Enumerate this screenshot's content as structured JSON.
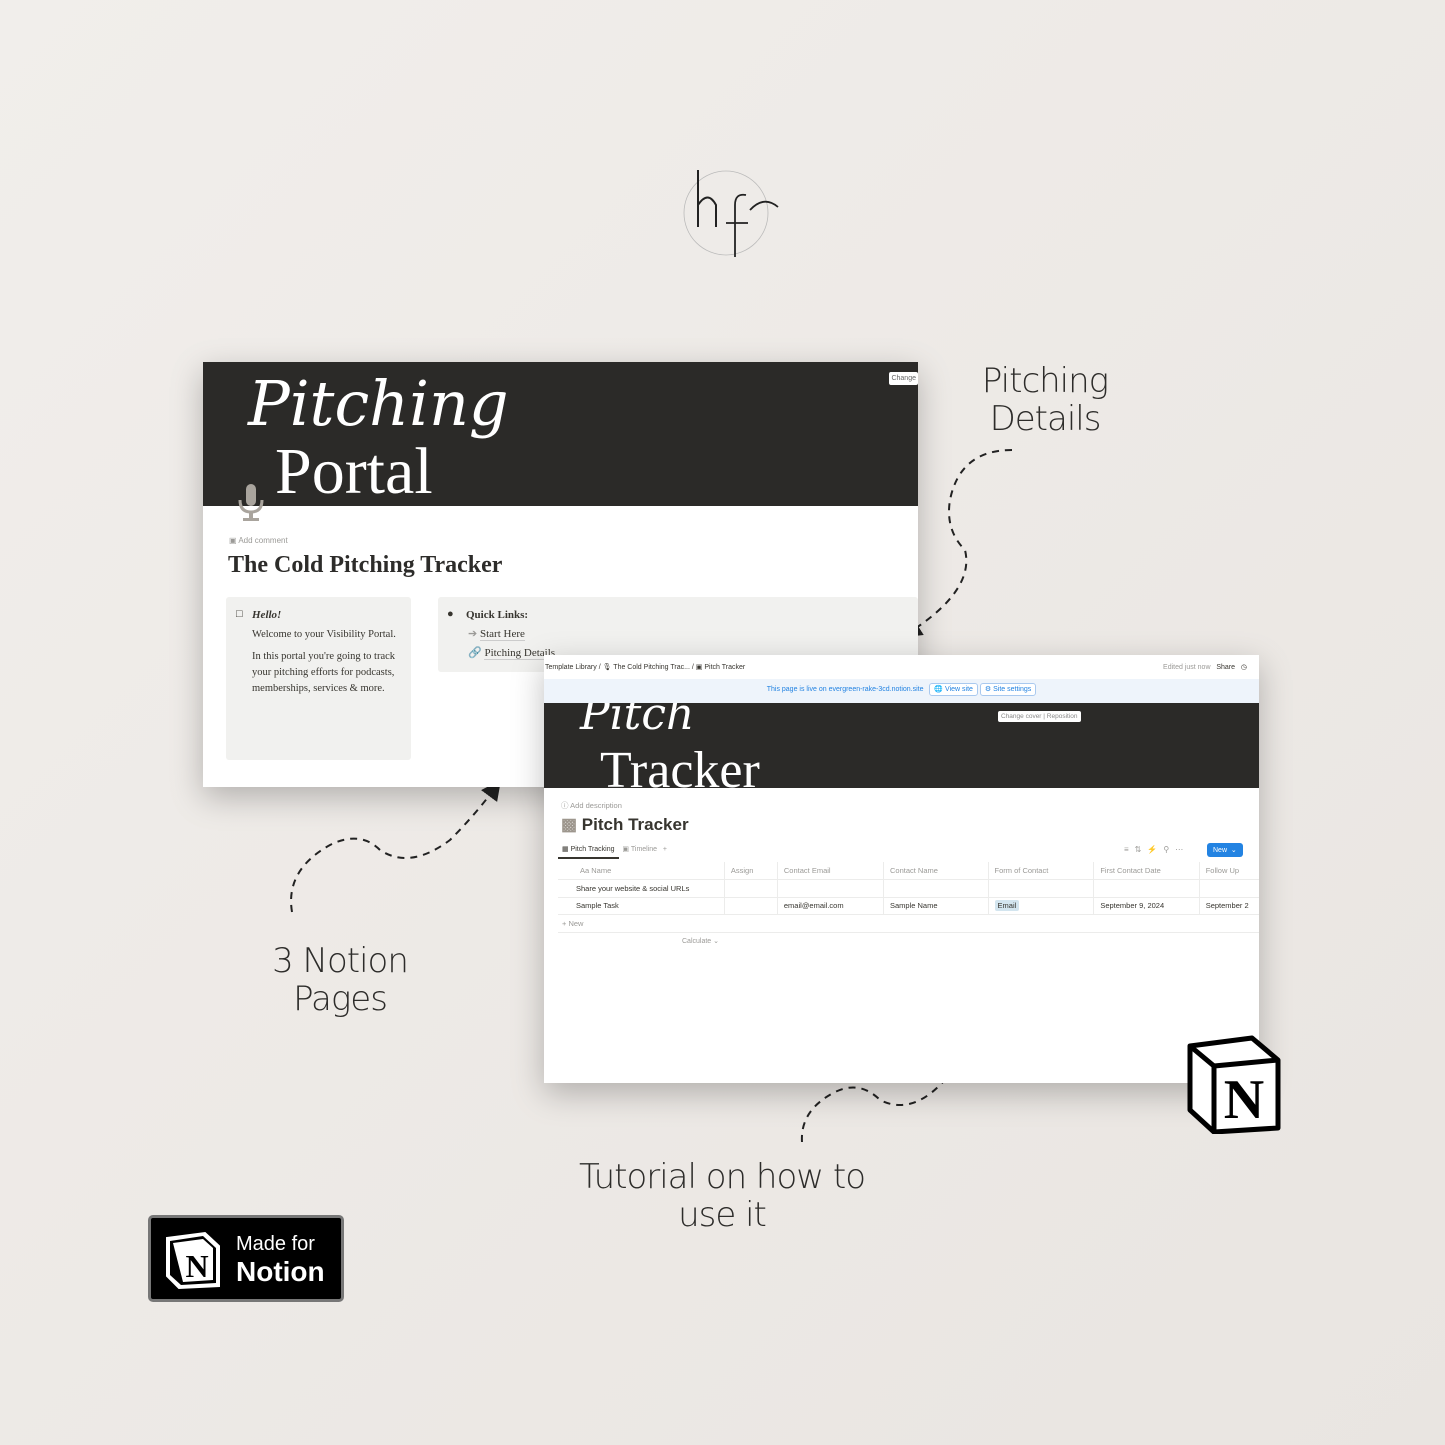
{
  "logo": {
    "text": "hf"
  },
  "labels": {
    "pitching_details": [
      "Pitching",
      "Details"
    ],
    "notion_pages": [
      "3 Notion",
      "Pages"
    ],
    "tutorial": [
      "Tutorial on how to",
      "use it"
    ]
  },
  "portal": {
    "cover_script": "Pitching",
    "cover_serif": "Portal",
    "change_button": "Change",
    "add_comment": "Add comment",
    "title": "The Cold Pitching Tracker",
    "hello": {
      "heading": "Hello!",
      "p1": "Welcome to your Visibility Portal.",
      "p2": "In this portal you're going to track your pitching efforts for podcasts, memberships, services & more."
    },
    "quick_links": {
      "heading": "Quick Links:",
      "items": [
        "Start Here",
        "Pitching Details"
      ]
    }
  },
  "tracker": {
    "breadcrumb": [
      "Template Library",
      "The Cold Pitching Trac...",
      "Pitch Tracker"
    ],
    "edited": "Edited just now",
    "share": "Share",
    "banner": {
      "text": "This page is live on evergreen-rake-3cd.notion.site",
      "view_site": "View site",
      "site_settings": "Site settings"
    },
    "cover_script": "Pitch",
    "cover_serif": "Tracker",
    "change_cover": "Change cover",
    "reposition": "Reposition",
    "add_description": "Add description",
    "title": "Pitch Tracker",
    "tabs": [
      "Pitch Tracking",
      "Timeline"
    ],
    "new_button": "New",
    "columns": [
      "Aa Name",
      "Assign",
      "Contact Email",
      "Contact Name",
      "Form of Contact",
      "First Contact Date",
      "Follow Up"
    ],
    "rows": [
      [
        "Share your website & social URLs",
        "",
        "",
        "",
        "",
        "",
        ""
      ],
      [
        "Sample Task",
        "",
        "email@email.com",
        "Sample Name",
        "Email",
        "September 9, 2024",
        "September 2"
      ]
    ],
    "add_new": "+ New",
    "calculate": "Calculate"
  },
  "badge": {
    "line1": "Made for",
    "line2": "Notion"
  },
  "colors": {
    "accent": "#2383e2",
    "cover": "#2b2a28",
    "background": "#efebe8"
  }
}
